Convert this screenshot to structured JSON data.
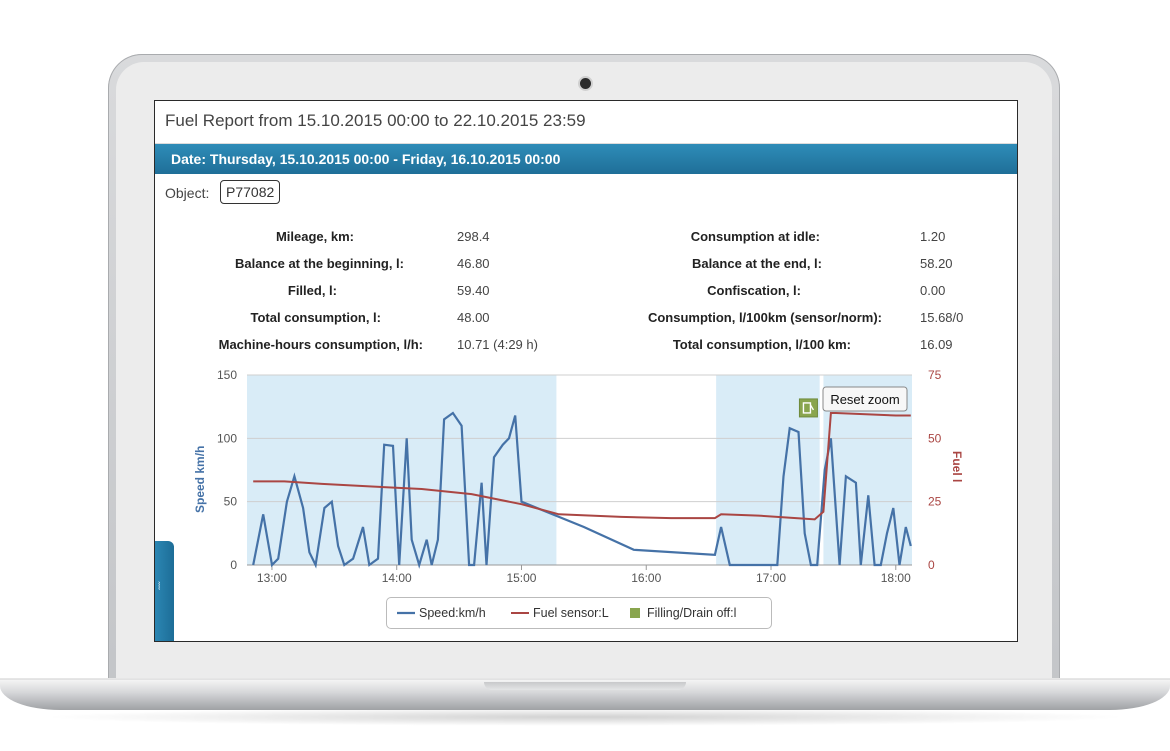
{
  "report": {
    "title": "Fuel Report from 15.10.2015 00:00 to 22.10.2015 23:59",
    "date_bar": "Date: Thursday, 15.10.2015 00:00 - Friday, 16.10.2015 00:00",
    "object_label": "Object:",
    "object_value": "P77082"
  },
  "stats": {
    "left": [
      {
        "label": "Mileage, km:",
        "value": "298.4"
      },
      {
        "label": "Balance at the beginning, l:",
        "value": "46.80"
      },
      {
        "label": "Filled, l:",
        "value": "59.40"
      },
      {
        "label": "Total consumption, l:",
        "value": "48.00"
      },
      {
        "label": "Machine-hours consumption, l/h:",
        "value": "10.71 (4:29 h)"
      }
    ],
    "right": [
      {
        "label": "Consumption at idle:",
        "value": "1.20"
      },
      {
        "label": "Balance at the end, l:",
        "value": "58.20"
      },
      {
        "label": "Confiscation, l:",
        "value": "0.00"
      },
      {
        "label": "Consumption, l/100km (sensor/norm):",
        "value": "15.68/0"
      },
      {
        "label": "Total consumption, l/100 km:",
        "value": "16.09"
      }
    ]
  },
  "chart_data": {
    "type": "line",
    "x_ticks": [
      "13:00",
      "14:00",
      "15:00",
      "16:00",
      "17:00",
      "18:00"
    ],
    "y_left": {
      "label": "Speed km/h",
      "ticks": [
        "0",
        "50",
        "100",
        "150"
      ],
      "range": [
        0,
        150
      ]
    },
    "y_right": {
      "label": "Fuel l",
      "ticks": [
        "0",
        "25",
        "50",
        "75"
      ],
      "range": [
        0,
        75
      ]
    },
    "reset_zoom_label": "Reset zoom",
    "legend": [
      "Speed:km/h",
      "Fuel sensor:L",
      "Filling/Drain off:l"
    ],
    "colors": {
      "speed": "#4572a7",
      "fuel": "#aa4643",
      "filling": "#89a54e",
      "band": "#d9ecf7"
    },
    "series": [
      {
        "name": "Speed:km/h",
        "points": [
          [
            12.85,
            0
          ],
          [
            12.93,
            40
          ],
          [
            13.0,
            0
          ],
          [
            13.05,
            5
          ],
          [
            13.12,
            50
          ],
          [
            13.18,
            70
          ],
          [
            13.25,
            45
          ],
          [
            13.3,
            10
          ],
          [
            13.35,
            0
          ],
          [
            13.42,
            45
          ],
          [
            13.48,
            50
          ],
          [
            13.53,
            15
          ],
          [
            13.58,
            0
          ],
          [
            13.65,
            5
          ],
          [
            13.73,
            30
          ],
          [
            13.78,
            0
          ],
          [
            13.85,
            5
          ],
          [
            13.9,
            95
          ],
          [
            13.97,
            94
          ],
          [
            14.02,
            0
          ],
          [
            14.08,
            100
          ],
          [
            14.12,
            20
          ],
          [
            14.18,
            0
          ],
          [
            14.24,
            20
          ],
          [
            14.28,
            0
          ],
          [
            14.33,
            20
          ],
          [
            14.38,
            115
          ],
          [
            14.45,
            120
          ],
          [
            14.52,
            110
          ],
          [
            14.58,
            0
          ],
          [
            14.62,
            0
          ],
          [
            14.68,
            65
          ],
          [
            14.72,
            0
          ],
          [
            14.78,
            85
          ],
          [
            14.85,
            95
          ],
          [
            14.9,
            100
          ],
          [
            14.95,
            118
          ],
          [
            15.0,
            50
          ],
          [
            15.5,
            30
          ],
          [
            15.9,
            12
          ],
          [
            16.55,
            8
          ],
          [
            16.6,
            30
          ],
          [
            16.67,
            0
          ],
          [
            17.05,
            0
          ],
          [
            17.1,
            70
          ],
          [
            17.15,
            108
          ],
          [
            17.22,
            105
          ],
          [
            17.27,
            25
          ],
          [
            17.32,
            0
          ],
          [
            17.37,
            0
          ],
          [
            17.43,
            75
          ],
          [
            17.48,
            100
          ],
          [
            17.55,
            0
          ],
          [
            17.6,
            70
          ],
          [
            17.68,
            65
          ],
          [
            17.72,
            0
          ],
          [
            17.78,
            55
          ],
          [
            17.83,
            0
          ],
          [
            17.88,
            0
          ],
          [
            17.93,
            25
          ],
          [
            17.98,
            45
          ],
          [
            18.03,
            0
          ],
          [
            18.08,
            30
          ],
          [
            18.12,
            15
          ]
        ],
        "cutouts": []
      },
      {
        "name": "Fuel sensor:L",
        "points": [
          [
            12.85,
            33
          ],
          [
            13.1,
            33
          ],
          [
            13.4,
            32
          ],
          [
            13.8,
            31
          ],
          [
            14.2,
            30
          ],
          [
            14.6,
            28
          ],
          [
            15.0,
            24
          ],
          [
            15.3,
            20
          ],
          [
            15.8,
            19
          ],
          [
            16.2,
            18.5
          ],
          [
            16.55,
            18.5
          ],
          [
            16.6,
            20
          ],
          [
            16.9,
            19.5
          ],
          [
            17.2,
            18.5
          ],
          [
            17.35,
            18
          ],
          [
            17.42,
            21
          ],
          [
            17.48,
            60
          ],
          [
            17.52,
            60
          ],
          [
            18.0,
            59
          ],
          [
            18.12,
            59
          ]
        ]
      }
    ],
    "filling_marker": {
      "x": 17.3,
      "y": 62
    },
    "x_range": [
      12.8,
      18.13
    ]
  }
}
